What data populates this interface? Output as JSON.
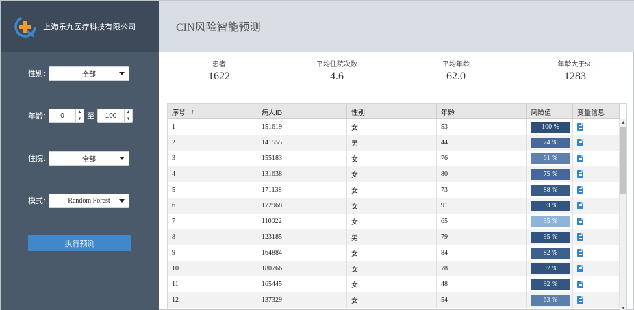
{
  "brand": {
    "name": "上海乐九医疗科技有限公司"
  },
  "page": {
    "title": "CIN风险智能预测"
  },
  "filters": {
    "gender": {
      "label": "性别:",
      "value": "全部"
    },
    "age": {
      "label": "年龄:",
      "min": "0",
      "to": "至",
      "max": "100"
    },
    "hospitalized": {
      "label": "住院:",
      "value": "全部"
    },
    "model": {
      "label": "模式:",
      "value": "Random Forest"
    },
    "run_label": "执行预测"
  },
  "stats": [
    {
      "label": "患者",
      "value": "1622"
    },
    {
      "label": "平均住院次数",
      "value": "4.6"
    },
    {
      "label": "平均年龄",
      "value": "62.0"
    },
    {
      "label": "年龄大于50",
      "value": "1283"
    }
  ],
  "table": {
    "columns": [
      "序号",
      "病人ID",
      "性别",
      "年龄",
      "风险值",
      "变量信息"
    ],
    "sort_indicator": "↑",
    "rows": [
      {
        "index": "1",
        "patient_id": "151619",
        "gender": "女",
        "age": "53",
        "risk": "100 %",
        "risk_color": "#2e4f7a"
      },
      {
        "index": "2",
        "patient_id": "141555",
        "gender": "男",
        "age": "44",
        "risk": "74 %",
        "risk_color": "#46689a"
      },
      {
        "index": "3",
        "patient_id": "155183",
        "gender": "女",
        "age": "76",
        "risk": "61 %",
        "risk_color": "#5f81ad"
      },
      {
        "index": "4",
        "patient_id": "131638",
        "gender": "女",
        "age": "80",
        "risk": "75 %",
        "risk_color": "#45679a"
      },
      {
        "index": "5",
        "patient_id": "171138",
        "gender": "女",
        "age": "73",
        "risk": "88 %",
        "risk_color": "#375a87"
      },
      {
        "index": "6",
        "patient_id": "172968",
        "gender": "女",
        "age": "91",
        "risk": "93 %",
        "risk_color": "#335581"
      },
      {
        "index": "7",
        "patient_id": "110022",
        "gender": "女",
        "age": "65",
        "risk": "35 %",
        "risk_color": "#8fb4d9"
      },
      {
        "index": "8",
        "patient_id": "123185",
        "gender": "男",
        "age": "79",
        "risk": "95 %",
        "risk_color": "#31537f"
      },
      {
        "index": "9",
        "patient_id": "164884",
        "gender": "女",
        "age": "84",
        "risk": "82 %",
        "risk_color": "#3d5f8e"
      },
      {
        "index": "10",
        "patient_id": "180766",
        "gender": "女",
        "age": "78",
        "risk": "97 %",
        "risk_color": "#30527d"
      },
      {
        "index": "11",
        "patient_id": "165445",
        "gender": "女",
        "age": "48",
        "risk": "92 %",
        "risk_color": "#345682"
      },
      {
        "index": "12",
        "patient_id": "137329",
        "gender": "女",
        "age": "54",
        "risk": "63 %",
        "risk_color": "#5c7eab"
      }
    ]
  },
  "colors": {
    "sidebar": "#4b5a6b",
    "brand_bar": "#3c4a5a",
    "accent_button": "#3f88cc",
    "topbar": "#d9dde4"
  },
  "icons": {
    "logo": "medical-cross-logo-icon",
    "sort": "sort-asc-icon",
    "detail": "document-icon"
  }
}
